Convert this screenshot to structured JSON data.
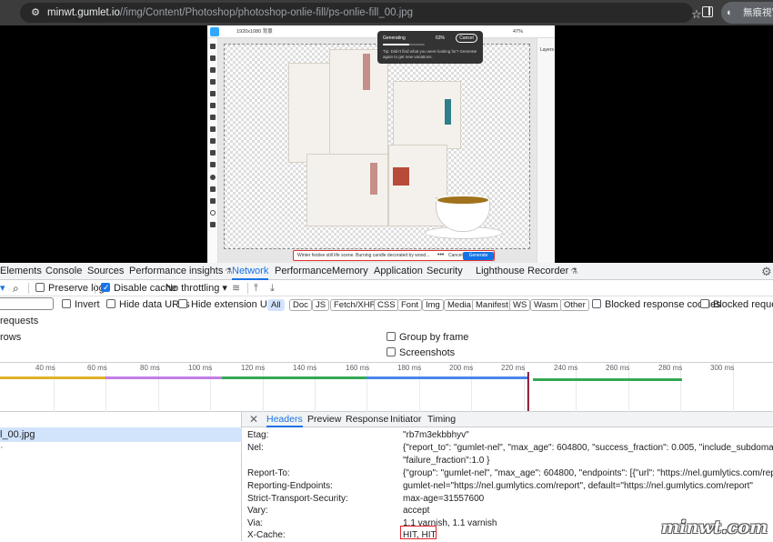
{
  "browser": {
    "url_host": "minwt.gumlet.io",
    "url_path": "//img/Content/Photoshop/photoshop-onlie-fill/ps-onlie-fill_00.jpg",
    "incognito_label": "無痕視窗"
  },
  "photoshop": {
    "file_name": "1920x1080 背景",
    "zoom": "47%",
    "panel_title": "Layers",
    "popup": {
      "title": "Generating",
      "percent": "63%",
      "progress": 0.63,
      "cancel": "Cancel",
      "tip": "Tip: Didn't find what you were looking for? Generate again to get new variations."
    },
    "prompt": {
      "text": "Winter festive still life scene. Burning candle decorated by wood...",
      "more": "•••",
      "cancel": "Cancel",
      "generate": "Generate"
    }
  },
  "devtools": {
    "tabs": [
      {
        "label": "Elements"
      },
      {
        "label": "Console"
      },
      {
        "label": "Sources"
      },
      {
        "label": "Performance insights",
        "flask": "⚗"
      },
      {
        "label": "Network",
        "active": true
      },
      {
        "label": "Performance"
      },
      {
        "label": "Memory"
      },
      {
        "label": "Application"
      },
      {
        "label": "Security"
      },
      {
        "label": "Lighthouse"
      },
      {
        "label": "Recorder",
        "flask": "⚗"
      }
    ],
    "toolbar": {
      "preserve_log": "Preserve log",
      "disable_cache": "Disable cache",
      "throttling": "No throttling"
    },
    "filters": {
      "invert": "Invert",
      "hide_data_urls": "Hide data URLs",
      "hide_extension_urls": "Hide extension URLs",
      "chips": [
        "All",
        "Doc",
        "JS",
        "Fetch/XHR",
        "CSS",
        "Font",
        "Img",
        "Media",
        "Manifest",
        "WS",
        "Wasm",
        "Other"
      ],
      "blocked_response_cookies": "Blocked response cookies",
      "blocked_requests": "Blocked requests"
    },
    "requests_label": "requests",
    "rows_label": "rows",
    "group_by_frame": "Group by frame",
    "screenshots": "Screenshots",
    "timeline_ticks": [
      "40 ms",
      "60 ms",
      "80 ms",
      "100 ms",
      "120 ms",
      "140 ms",
      "160 ms",
      "180 ms",
      "200 ms",
      "220 ms",
      "240 ms",
      "260 ms",
      "280 ms",
      "300 ms"
    ],
    "request_name": "l_00.jpg",
    "detail_tabs": [
      "Headers",
      "Preview",
      "Response",
      "Initiator",
      "Timing"
    ],
    "headers": [
      {
        "name": "Etag:",
        "value": "\"rb7m3ekbbhyv\""
      },
      {
        "name": "Nel:",
        "value": "{\"report_to\": \"gumlet-nel\", \"max_age\": 604800, \"success_fraction\": 0.005, \"include_subdomains\":true,"
      },
      {
        "name": "",
        "value": "\"failure_fraction\":1.0 }"
      },
      {
        "name": "Report-To:",
        "value": "{\"group\": \"gumlet-nel\", \"max_age\": 604800, \"endpoints\": [{\"url\": \"https://nel.gumlytics.com/report\"}]}"
      },
      {
        "name": "Reporting-Endpoints:",
        "value": "gumlet-nel=\"https://nel.gumlytics.com/report\", default=\"https://nel.gumlytics.com/report\""
      },
      {
        "name": "Strict-Transport-Security:",
        "value": "max-age=31557600"
      },
      {
        "name": "Vary:",
        "value": "accept"
      },
      {
        "name": "Via:",
        "value": "1.1 varnish, 1.1 varnish"
      },
      {
        "name": "X-Cache:",
        "value": "HIT, HIT"
      }
    ]
  },
  "watermark": "minwt.com",
  "colors": {
    "accent": "#1a73e8",
    "highlight": "#e0242b"
  }
}
